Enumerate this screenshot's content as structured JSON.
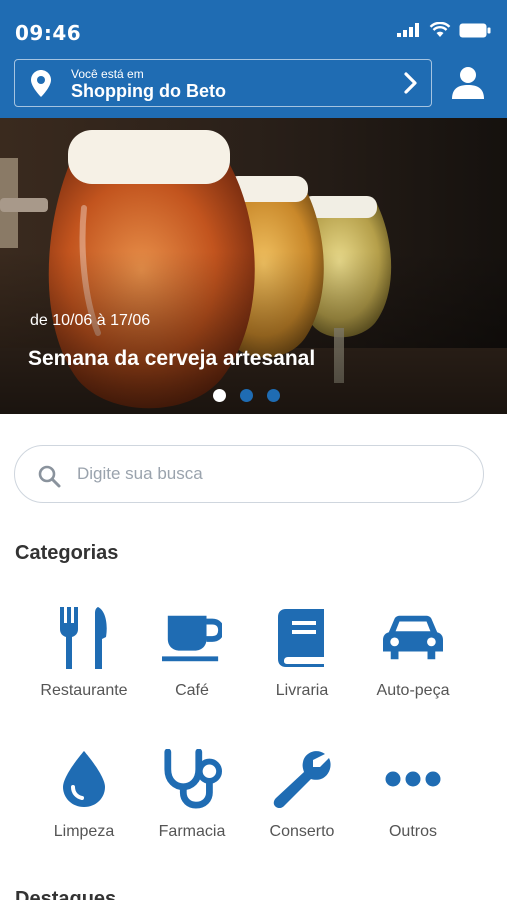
{
  "status_bar": {
    "time": "09:46",
    "icons": [
      "signal-icon",
      "wifi-icon",
      "battery-icon"
    ]
  },
  "location": {
    "label": "Você está em",
    "name": "Shopping do Beto"
  },
  "banner": {
    "date": "de 10/06 à 17/06",
    "title": "Semana da cerveja artesanal",
    "slides": 3,
    "active_slide": 1
  },
  "search": {
    "placeholder": "Digite sua busca"
  },
  "categories": {
    "title": "Categorias",
    "items": [
      {
        "label": "Restaurante",
        "icon": "fork-knife-icon"
      },
      {
        "label": "Café",
        "icon": "coffee-cup-icon"
      },
      {
        "label": "Livraria",
        "icon": "book-icon"
      },
      {
        "label": "Auto-peça",
        "icon": "car-icon"
      },
      {
        "label": "Limpeza",
        "icon": "drop-icon"
      },
      {
        "label": "Farmacia",
        "icon": "stethoscope-icon"
      },
      {
        "label": "Conserto",
        "icon": "wrench-icon"
      },
      {
        "label": "Outros",
        "icon": "more-dots-icon"
      }
    ]
  },
  "next_section": {
    "title": "Destaques"
  },
  "colors": {
    "primary": "#1f6cb3",
    "icon": "#1f6cb3",
    "text": "#333333"
  }
}
